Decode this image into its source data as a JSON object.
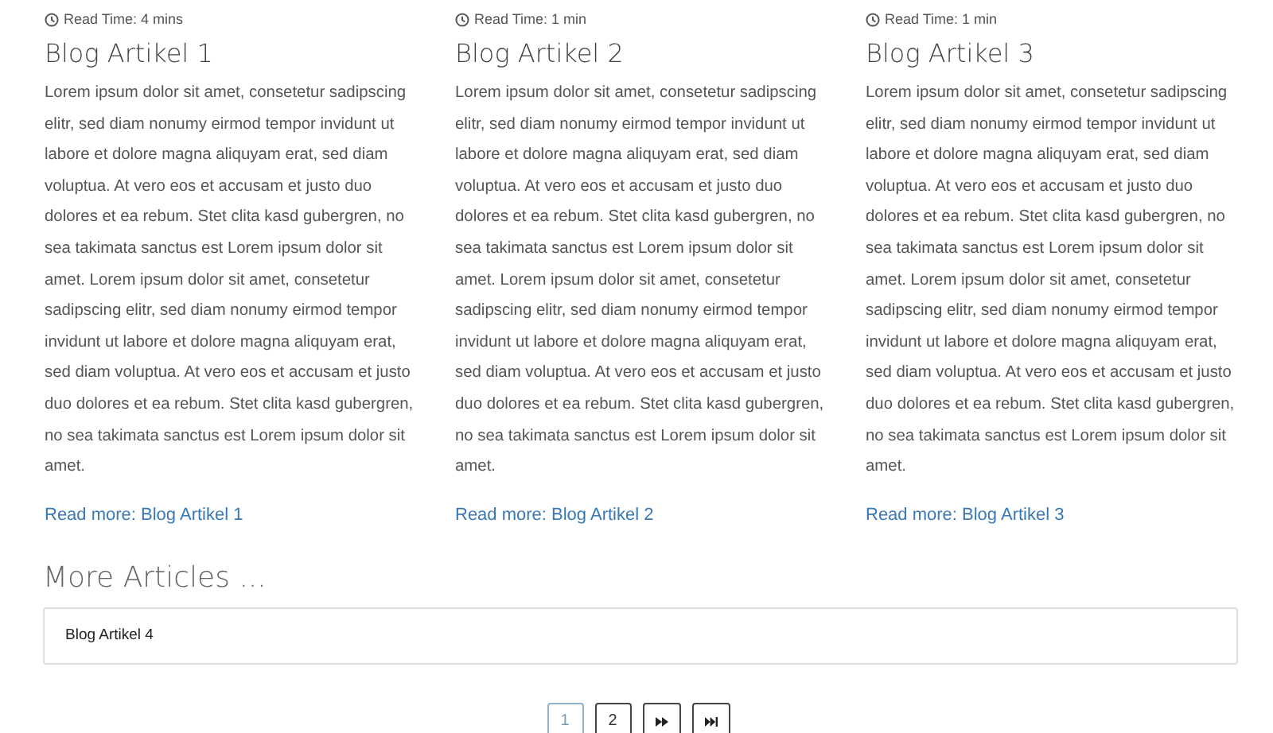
{
  "articles": [
    {
      "read_time": "Read Time: 4 mins",
      "title": "Blog Artikel 1",
      "body": "Lorem ipsum dolor sit amet, consetetur sadipscing elitr, sed diam nonumy eirmod tempor invidunt ut labore et dolore magna aliquyam erat, sed diam voluptua. At vero eos et accusam et justo duo dolores et ea rebum. Stet clita kasd gubergren, no sea takimata sanctus est Lorem ipsum dolor sit amet. Lorem ipsum dolor sit amet, consetetur sadipscing elitr, sed diam nonumy eirmod tempor invidunt ut labore et dolore magna aliquyam erat, sed diam voluptua. At vero eos et accusam et justo duo dolores et ea rebum. Stet clita kasd gubergren, no sea takimata sanctus est Lorem ipsum dolor sit amet.",
      "link": "Read more: Blog Artikel 1"
    },
    {
      "read_time": "Read Time: 1 min",
      "title": "Blog Artikel 2",
      "body": "Lorem ipsum dolor sit amet, consetetur sadipscing elitr, sed diam nonumy eirmod tempor invidunt ut labore et dolore magna aliquyam erat, sed diam voluptua. At vero eos et accusam et justo duo dolores et ea rebum. Stet clita kasd gubergren, no sea takimata sanctus est Lorem ipsum dolor sit amet. Lorem ipsum dolor sit amet, consetetur sadipscing elitr, sed diam nonumy eirmod tempor invidunt ut labore et dolore magna aliquyam erat, sed diam voluptua. At vero eos et accusam et justo duo dolores et ea rebum. Stet clita kasd gubergren, no sea takimata sanctus est Lorem ipsum dolor sit amet.",
      "link": "Read more: Blog Artikel 2"
    },
    {
      "read_time": "Read Time: 1 min",
      "title": "Blog Artikel 3",
      "body": "Lorem ipsum dolor sit amet, consetetur sadipscing elitr, sed diam nonumy eirmod tempor invidunt ut labore et dolore magna aliquyam erat, sed diam voluptua. At vero eos et accusam et justo duo dolores et ea rebum. Stet clita kasd gubergren, no sea takimata sanctus est Lorem ipsum dolor sit amet. Lorem ipsum dolor sit amet, consetetur sadipscing elitr, sed diam nonumy eirmod tempor invidunt ut labore et dolore magna aliquyam erat, sed diam voluptua. At vero eos et accusam et justo duo dolores et ea rebum. Stet clita kasd gubergren, no sea takimata sanctus est Lorem ipsum dolor sit amet.",
      "link": "Read more: Blog Artikel 3"
    }
  ],
  "more_articles": {
    "heading": "More Articles ...",
    "items": [
      "Blog Artikel 4"
    ]
  },
  "pagination": {
    "pages": [
      {
        "label": "1",
        "selected": true
      },
      {
        "label": "2",
        "selected": false
      }
    ]
  }
}
